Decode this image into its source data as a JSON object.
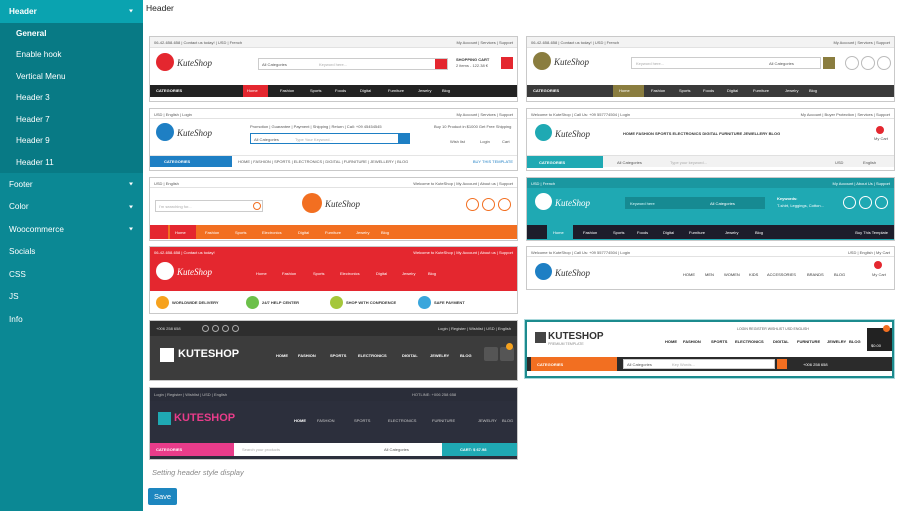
{
  "sidebar": {
    "header": "Header",
    "sub_items": [
      "General",
      "Enable hook",
      "Vertical Menu",
      "Header 3",
      "Header 7",
      "Header 9",
      "Header 11"
    ],
    "items": [
      {
        "label": "Footer",
        "caret": true
      },
      {
        "label": "Color",
        "caret": true
      },
      {
        "label": "Woocommerce",
        "caret": true
      },
      {
        "label": "Socials",
        "caret": false
      },
      {
        "label": "CSS",
        "caret": false
      },
      {
        "label": "JS",
        "caret": false
      },
      {
        "label": "Info",
        "caret": false
      }
    ]
  },
  "main": {
    "title": "Header",
    "hint": "Setting header style display",
    "save_label": "Save"
  },
  "thumbs": {
    "t1": {
      "topbar": "06-42-658-658 | Contact us today! | USD | French",
      "topright": "My Account | Services | Support",
      "category": "All Categories",
      "search": "Keyword here...",
      "cart": "SHOPPING CART",
      "cart_sub": "2 items - 122.38 €",
      "nav": [
        "CATEGORIES",
        "Home",
        "Fashion",
        "Sports",
        "Foods",
        "Digital",
        "Furniture",
        "Jewelry",
        "Blog"
      ]
    },
    "t2": {
      "topbar": "06-42-658-658 | Contact us today! | USD | French",
      "topright": "My Account | Services | Support",
      "search": "Keyword here...",
      "category": "All Categories",
      "nav": [
        "CATEGORIES",
        "Home",
        "Fashion",
        "Sports",
        "Foods",
        "Digital",
        "Furniture",
        "Jewelry",
        "Blog"
      ]
    },
    "t3": {
      "topbar": "USD | English | Login",
      "topright": "My Account | Services | Support",
      "promo": "Promotion | Guarantee | Payment | Shipping | Return | Call: +09 45454545",
      "promo2": "Buy 10 Product in $1000 Get Free Shipping",
      "category": "All Categories",
      "search": "Type Your Keyword...",
      "wishlist": "Wish list",
      "login": "Login",
      "cart": "Cart",
      "cat_bar": "CATEGORIES",
      "nav": "HOME | FASHION | SPORTS | ELECTRONICS | DIGITAL | FURNITURE | JEWELLERY | BLOG",
      "buy": "BUY THIS TEMPLATE"
    },
    "t4": {
      "topbar": "Welcome to KuteShop | Call Us: +09 557774504 | Login",
      "topright": "My Account | Buyer Protection | Services | Support",
      "nav": "HOME  FASHION  SPORTS  ELECTRONICS  DIGITAL  FURNITURE  JEWELLERY  BLOG",
      "mycart": "My Cart",
      "cat_bar": "CATEGORIES",
      "category": "All Categories",
      "search": "Type your keyword...",
      "currency": "USD",
      "lang": "English"
    },
    "t5": {
      "topbar": "USD | English",
      "topright": "Welcome to KuteShop | My Account | About us | Support",
      "search": "I'm searching for...",
      "nav": [
        "Home",
        "Fashion",
        "Sports",
        "Electronics",
        "Digital",
        "Furniture",
        "Jewelry",
        "Blog"
      ]
    },
    "t6": {
      "topbar": "USD | French",
      "topright": "My Account | About Us | Support",
      "search": "Keyword here",
      "category": "All Categories",
      "keywords": "Keywords:",
      "keywords2": "T-shirt, Leggings, Cotton...",
      "nav": [
        "Home",
        "Fashion",
        "Sports",
        "Foods",
        "Digital",
        "Furniture",
        "Jewelry",
        "Blog"
      ],
      "buy": "Buy This Template"
    },
    "t7": {
      "topbar": "06-42-658-658 | Contact us today!",
      "topright": "Welcome to KuteShop | My Account | About us | Support",
      "nav": [
        "Home",
        "Fashion",
        "Sports",
        "Electronics",
        "Digital",
        "Jewelry",
        "Blog"
      ],
      "features": [
        "WORLDWIDE DELIVERY",
        "24/7 HELP CENTER",
        "SHOP WITH CONFIDENCE",
        "SAFE PAYMENT"
      ]
    },
    "t8": {
      "topbar": "Welcome to KuteShop | Call Us: +09 557774504 | Login",
      "topright": "USD | English | My Cart",
      "nav": [
        "HOME",
        "MEN",
        "WOMEN",
        "KIDS",
        "ACCESSORIES",
        "BRANDS",
        "BLOG"
      ],
      "mycart": "My Cart"
    },
    "t9": {
      "phone": "+006 258 658",
      "topright": "Login | Register | Wishlist | USD | English",
      "logo": "KUTESHOP",
      "nav": [
        "HOME",
        "FASHION",
        "SPORTS",
        "ELECTRONICS",
        "DIGITAL",
        "JEWELRY",
        "BLOG"
      ]
    },
    "t10": {
      "topright": "LOGIN  REGISTER  WISHLIST  USD  ENGLISH",
      "logo": "KUTESHOP",
      "tagline": "PREMIUM TEMPLATE",
      "nav": [
        "HOME",
        "FASHION",
        "SPORTS",
        "ELECTRONICS",
        "DIGITAL",
        "FURNITURE",
        "JEWELRY",
        "BLOG"
      ],
      "price": "$0.00",
      "cat": "CATEGORIES",
      "category": "All Categories",
      "search": "Key Words...",
      "phone": "+006 258 658"
    },
    "t11": {
      "topbar": "Login | Register | Wishlist | USD | English",
      "hotline": "HOTLINE: +006 258 658",
      "logo": "KUTESHOP",
      "nav": [
        "HOME",
        "FASHION",
        "SPORTS",
        "ELECTRONICS",
        "FURNITURE",
        "JEWELRY",
        "BLOG"
      ],
      "cat": "CATEGORIES",
      "search": "Search your products",
      "category": "All Categories",
      "cart": "CART: $ 67.98"
    }
  },
  "colors": {
    "sidebar": "#0b8894",
    "sidebar_active": "#0aa3b0",
    "red": "#e4272f",
    "orange": "#f26f21",
    "teal": "#1fa9b3",
    "blue": "#1e7fc4"
  }
}
